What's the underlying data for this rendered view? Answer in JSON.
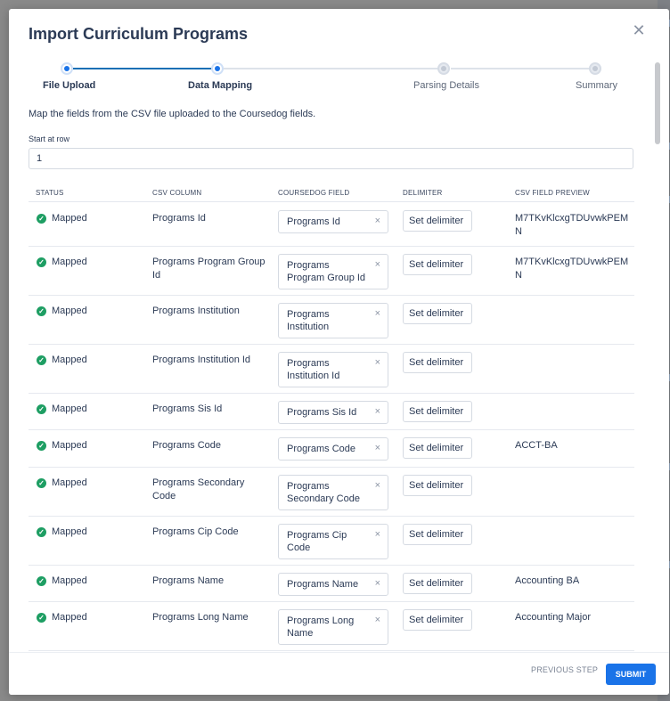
{
  "modal": {
    "title": "Import Curriculum Programs",
    "close_icon": "close-icon"
  },
  "colors": {
    "accent": "#1a73e8",
    "mapped_status": "#1e9e63",
    "title": "#2b3a55"
  },
  "steps": [
    {
      "label": "File Upload",
      "state": "completed"
    },
    {
      "label": "Data Mapping",
      "state": "current"
    },
    {
      "label": "Parsing Details",
      "state": "pending"
    },
    {
      "label": "Summary",
      "state": "pending"
    }
  ],
  "instructions": "Map the fields from the CSV file uploaded to the Coursedog fields.",
  "start_row": {
    "label": "Start at row",
    "value": "1"
  },
  "table": {
    "headers": [
      "STATUS",
      "CSV COLUMN",
      "COURSEDOG FIELD",
      "DELIMITER",
      "CSV FIELD PREVIEW"
    ],
    "rows": [
      {
        "status": "Mapped",
        "csv_column": "Programs Id",
        "coursedog_field": "Programs Id",
        "delimiter": "Set delimiter",
        "preview": "M7TKvKlcxgTDUvwkPEMN"
      },
      {
        "status": "Mapped",
        "csv_column": "Programs Program Group Id",
        "coursedog_field": "Programs Program Group Id",
        "delimiter": "Set delimiter",
        "preview": "M7TKvKlcxgTDUvwkPEMN"
      },
      {
        "status": "Mapped",
        "csv_column": "Programs Institution",
        "coursedog_field": "Programs Institution",
        "delimiter": "Set delimiter",
        "preview": ""
      },
      {
        "status": "Mapped",
        "csv_column": "Programs Institution Id",
        "coursedog_field": "Programs Institution Id",
        "delimiter": "Set delimiter",
        "preview": ""
      },
      {
        "status": "Mapped",
        "csv_column": "Programs Sis Id",
        "coursedog_field": "Programs Sis Id",
        "delimiter": "Set delimiter",
        "preview": ""
      },
      {
        "status": "Mapped",
        "csv_column": "Programs Code",
        "coursedog_field": "Programs Code",
        "delimiter": "Set delimiter",
        "preview": "ACCT-BA"
      },
      {
        "status": "Mapped",
        "csv_column": "Programs Secondary Code",
        "coursedog_field": "Programs Secondary Code",
        "delimiter": "Set delimiter",
        "preview": ""
      },
      {
        "status": "Mapped",
        "csv_column": "Programs Cip Code",
        "coursedog_field": "Programs Cip Code",
        "delimiter": "Set delimiter",
        "preview": ""
      },
      {
        "status": "Mapped",
        "csv_column": "Programs Name",
        "coursedog_field": "Programs Name",
        "delimiter": "Set delimiter",
        "preview": "Accounting BA"
      },
      {
        "status": "Mapped",
        "csv_column": "Programs Long Name",
        "coursedog_field": "Programs Long Name",
        "delimiter": "Set delimiter",
        "preview": "Accounting Major"
      }
    ]
  },
  "footer": {
    "previous_label": "PREVIOUS STEP",
    "submit_label": "SUBMIT"
  }
}
